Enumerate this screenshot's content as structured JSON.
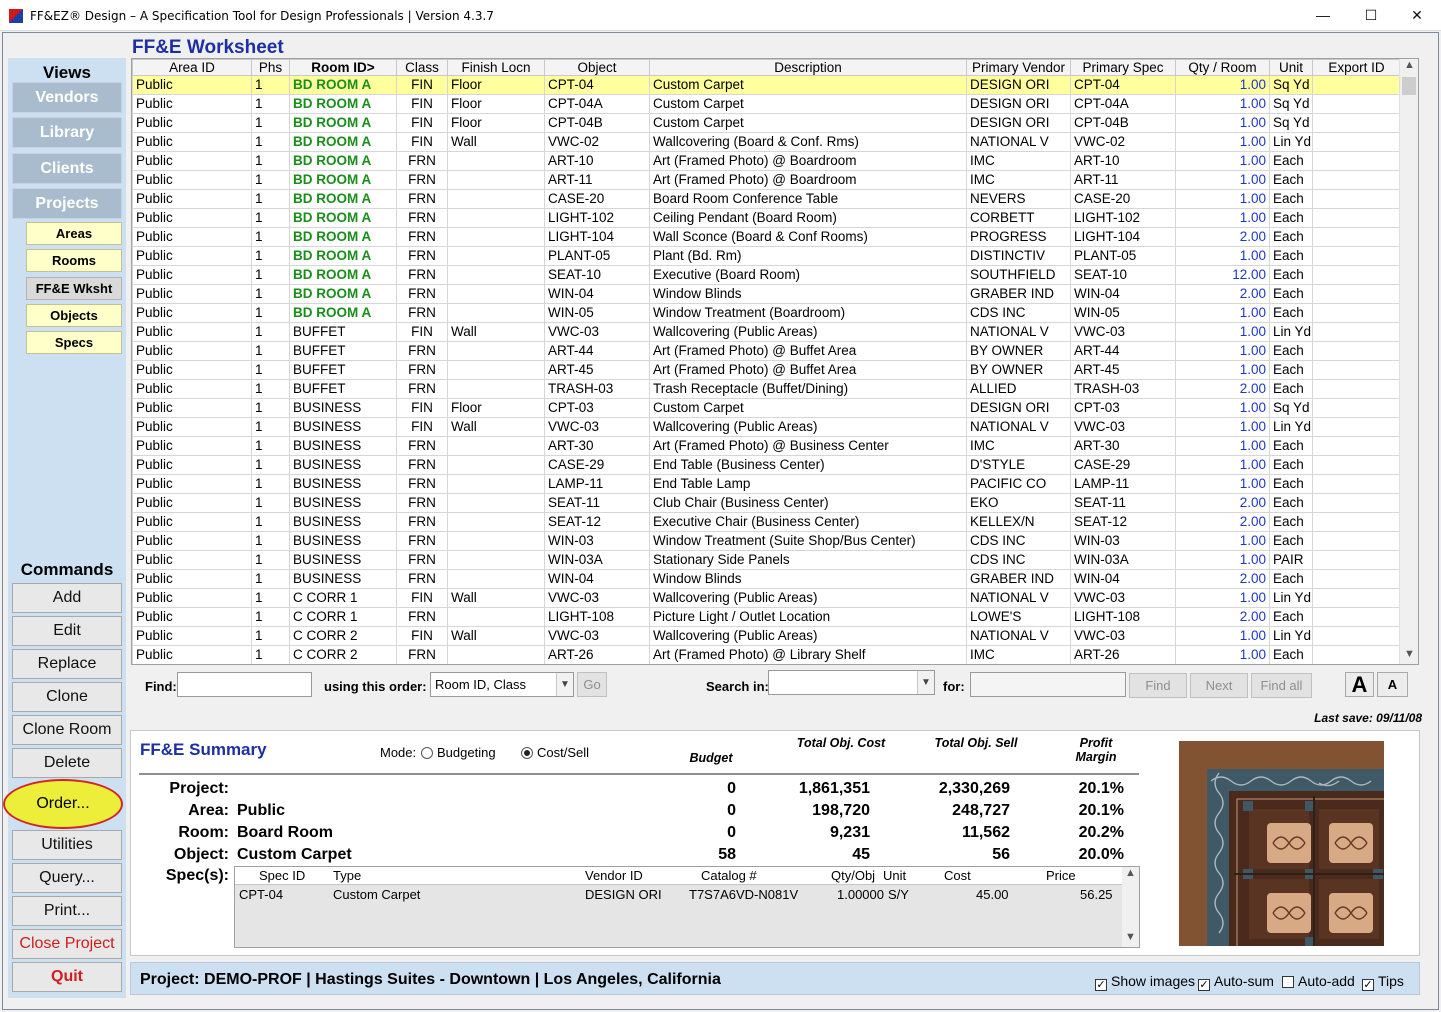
{
  "window": {
    "title": "FF&EZ® Design – A Specification Tool for Design Professionals | Version 4.3.7",
    "min": "—",
    "max": "☐",
    "close": "✕"
  },
  "sidebar": {
    "views_label": "Views",
    "views": [
      "Vendors",
      "Library",
      "Clients",
      "Projects"
    ],
    "project_views": [
      "Areas",
      "Rooms",
      "FF&E Wksht",
      "Objects",
      "Specs"
    ],
    "commands_label": "Commands",
    "commands": [
      "Add",
      "Edit",
      "Replace",
      "Clone",
      "Clone Room",
      "Delete",
      "Order...",
      "Utilities",
      "Query...",
      "Print...",
      "Close Project",
      "Quit"
    ]
  },
  "worksheet": {
    "title": "FF&E Worksheet",
    "columns": [
      "Area ID",
      "Phs",
      "Room ID>",
      "Class",
      "Finish Locn",
      "Object",
      "Description",
      "Primary Vendor",
      "Primary Spec",
      "Qty / Room",
      "Unit",
      "Export ID"
    ],
    "rows": [
      [
        "Public",
        "1",
        "BD ROOM A",
        "FIN",
        "Floor",
        "CPT-04",
        "Custom Carpet",
        "DESIGN ORI",
        "CPT-04",
        "1.00",
        "Sq Yd",
        ""
      ],
      [
        "Public",
        "1",
        "BD ROOM A",
        "FIN",
        "Floor",
        "CPT-04A",
        "Custom Carpet",
        "DESIGN ORI",
        "CPT-04A",
        "1.00",
        "Sq Yd",
        ""
      ],
      [
        "Public",
        "1",
        "BD ROOM A",
        "FIN",
        "Floor",
        "CPT-04B",
        "Custom Carpet",
        "DESIGN ORI",
        "CPT-04B",
        "1.00",
        "Sq Yd",
        ""
      ],
      [
        "Public",
        "1",
        "BD ROOM A",
        "FIN",
        "Wall",
        "VWC-02",
        "Wallcovering (Board & Conf. Rms)",
        "NATIONAL V",
        "VWC-02",
        "1.00",
        "Lin Yd",
        ""
      ],
      [
        "Public",
        "1",
        "BD ROOM A",
        "FRN",
        "",
        "ART-10",
        "Art  (Framed Photo) @ Boardroom",
        "IMC",
        "ART-10",
        "1.00",
        "Each",
        ""
      ],
      [
        "Public",
        "1",
        "BD ROOM A",
        "FRN",
        "",
        "ART-11",
        "Art  (Framed Photo) @ Boardroom",
        "IMC",
        "ART-11",
        "1.00",
        "Each",
        ""
      ],
      [
        "Public",
        "1",
        "BD ROOM A",
        "FRN",
        "",
        "CASE-20",
        "Board Room Conference Table",
        "NEVERS",
        "CASE-20",
        "1.00",
        "Each",
        ""
      ],
      [
        "Public",
        "1",
        "BD ROOM A",
        "FRN",
        "",
        "LIGHT-102",
        "Ceiling Pendant (Board Room)",
        "CORBETT",
        "LIGHT-102",
        "1.00",
        "Each",
        ""
      ],
      [
        "Public",
        "1",
        "BD ROOM A",
        "FRN",
        "",
        "LIGHT-104",
        "Wall Sconce (Board & Conf Rooms)",
        "PROGRESS",
        "LIGHT-104",
        "2.00",
        "Each",
        ""
      ],
      [
        "Public",
        "1",
        "BD ROOM A",
        "FRN",
        "",
        "PLANT-05",
        "Plant (Bd. Rm)",
        "DISTINCTIV",
        "PLANT-05",
        "1.00",
        "Each",
        ""
      ],
      [
        "Public",
        "1",
        "BD ROOM A",
        "FRN",
        "",
        "SEAT-10",
        "Executive  (Board Room)",
        "SOUTHFIELD",
        "SEAT-10",
        "12.00",
        "Each",
        ""
      ],
      [
        "Public",
        "1",
        "BD ROOM A",
        "FRN",
        "",
        "WIN-04",
        "Window Blinds",
        "GRABER IND",
        "WIN-04",
        "2.00",
        "Each",
        ""
      ],
      [
        "Public",
        "1",
        "BD ROOM A",
        "FRN",
        "",
        "WIN-05",
        "Window Treatment (Boardroom)",
        "CDS INC",
        "WIN-05",
        "1.00",
        "Each",
        ""
      ],
      [
        "Public",
        "1",
        "BUFFET",
        "FIN",
        "Wall",
        "VWC-03",
        "Wallcovering (Public Areas)",
        "NATIONAL V",
        "VWC-03",
        "1.00",
        "Lin Yd",
        ""
      ],
      [
        "Public",
        "1",
        "BUFFET",
        "FRN",
        "",
        "ART-44",
        "Art (Framed Photo) @  Buffet Area",
        "BY OWNER",
        "ART-44",
        "1.00",
        "Each",
        ""
      ],
      [
        "Public",
        "1",
        "BUFFET",
        "FRN",
        "",
        "ART-45",
        "Art (Framed Photo) @  Buffet Area",
        "BY OWNER",
        "ART-45",
        "1.00",
        "Each",
        ""
      ],
      [
        "Public",
        "1",
        "BUFFET",
        "FRN",
        "",
        "TRASH-03",
        "Trash Receptacle (Buffet/Dining)",
        "ALLIED",
        "TRASH-03",
        "2.00",
        "Each",
        ""
      ],
      [
        "Public",
        "1",
        "BUSINESS",
        "FIN",
        "Floor",
        "CPT-03",
        "Custom Carpet",
        "DESIGN ORI",
        "CPT-03",
        "1.00",
        "Sq Yd",
        ""
      ],
      [
        "Public",
        "1",
        "BUSINESS",
        "FIN",
        "Wall",
        "VWC-03",
        "Wallcovering (Public Areas)",
        "NATIONAL V",
        "VWC-03",
        "1.00",
        "Lin Yd",
        ""
      ],
      [
        "Public",
        "1",
        "BUSINESS",
        "FRN",
        "",
        "ART-30",
        "Art (Framed Photo) @ Business Center",
        "IMC",
        "ART-30",
        "1.00",
        "Each",
        ""
      ],
      [
        "Public",
        "1",
        "BUSINESS",
        "FRN",
        "",
        "CASE-29",
        "End Table (Business Center)",
        "D'STYLE",
        "CASE-29",
        "1.00",
        "Each",
        ""
      ],
      [
        "Public",
        "1",
        "BUSINESS",
        "FRN",
        "",
        "LAMP-11",
        "End Table Lamp",
        "PACIFIC CO",
        "LAMP-11",
        "1.00",
        "Each",
        ""
      ],
      [
        "Public",
        "1",
        "BUSINESS",
        "FRN",
        "",
        "SEAT-11",
        "Club Chair (Business Center)",
        "EKO",
        "SEAT-11",
        "2.00",
        "Each",
        ""
      ],
      [
        "Public",
        "1",
        "BUSINESS",
        "FRN",
        "",
        "SEAT-12",
        "Executive Chair (Business Center)",
        "KELLEX/N",
        "SEAT-12",
        "2.00",
        "Each",
        ""
      ],
      [
        "Public",
        "1",
        "BUSINESS",
        "FRN",
        "",
        "WIN-03",
        "Window Treatment (Suite Shop/Bus Center)",
        "CDS INC",
        "WIN-03",
        "1.00",
        "Each",
        ""
      ],
      [
        "Public",
        "1",
        "BUSINESS",
        "FRN",
        "",
        "WIN-03A",
        "Stationary Side Panels",
        "CDS INC",
        "WIN-03A",
        "1.00",
        "PAIR",
        ""
      ],
      [
        "Public",
        "1",
        "BUSINESS",
        "FRN",
        "",
        "WIN-04",
        "Window Blinds",
        "GRABER IND",
        "WIN-04",
        "2.00",
        "Each",
        ""
      ],
      [
        "Public",
        "1",
        "C CORR 1",
        "FIN",
        "Wall",
        "VWC-03",
        "Wallcovering (Public Areas)",
        "NATIONAL V",
        "VWC-03",
        "1.00",
        "Lin Yd",
        ""
      ],
      [
        "Public",
        "1",
        "C CORR 1",
        "FRN",
        "",
        "LIGHT-108",
        "Picture Light / Outlet Location",
        "LOWE'S",
        "LIGHT-108",
        "2.00",
        "Each",
        ""
      ],
      [
        "Public",
        "1",
        "C CORR 2",
        "FIN",
        "Wall",
        "VWC-03",
        "Wallcovering (Public Areas)",
        "NATIONAL V",
        "VWC-03",
        "1.00",
        "Lin Yd",
        ""
      ],
      [
        "Public",
        "1",
        "C CORR 2",
        "FRN",
        "",
        "ART-26",
        "Art (Framed Photo) @ Library Shelf",
        "IMC",
        "ART-26",
        "1.00",
        "Each",
        ""
      ]
    ]
  },
  "findbar": {
    "find_label": "Find:",
    "find_value": "",
    "order_label": "using this order:",
    "order_value": "Room ID, Class",
    "go": "Go",
    "search_label": "Search in:",
    "search_value": "",
    "for_label": "for:",
    "for_value": "",
    "find_btn": "Find",
    "next_btn": "Next",
    "findall_btn": "Find all",
    "font_large": "A",
    "font_small": "A"
  },
  "last_save": "Last save: 09/11/08",
  "summary": {
    "title": "FF&E Summary",
    "mode_label": "Mode:",
    "mode_budgeting": "Budgeting",
    "mode_costsell": "Cost/Sell",
    "col_budget": "Budget",
    "col_cost": "Total Obj. Cost",
    "col_sell": "Total Obj. Sell",
    "col_margin": "Profit Margin",
    "rows": [
      {
        "label": "Project:",
        "name": "",
        "budget": "0",
        "cost": "1,861,351",
        "sell": "2,330,269",
        "margin": "20.1%"
      },
      {
        "label": "Area:",
        "name": "Public",
        "budget": "0",
        "cost": "198,720",
        "sell": "248,727",
        "margin": "20.1%"
      },
      {
        "label": "Room:",
        "name": "Board Room",
        "budget": "0",
        "cost": "9,231",
        "sell": "11,562",
        "margin": "20.2%"
      },
      {
        "label": "Object:",
        "name": "Custom Carpet",
        "budget": "58",
        "cost": "45",
        "sell": "56",
        "margin": "20.0%"
      }
    ],
    "specs_label": "Spec(s):",
    "spec_columns": [
      "Spec ID",
      "Type",
      "Vendor ID",
      "Catalog #",
      "Qty/Obj",
      "Unit",
      "Cost",
      "Price"
    ],
    "spec_row": [
      "CPT-04",
      "Custom Carpet",
      "DESIGN ORI",
      "T7S7A6VD-N081V",
      "1.00000",
      "S/Y",
      "45.00",
      "56.25"
    ]
  },
  "status": {
    "text": "Project:  DEMO-PROF  |  Hastings Suites - Downtown  |  Los Angeles, California",
    "show_images": "Show images",
    "auto_sum": "Auto-sum",
    "auto_add": "Auto-add",
    "tips": "Tips"
  }
}
